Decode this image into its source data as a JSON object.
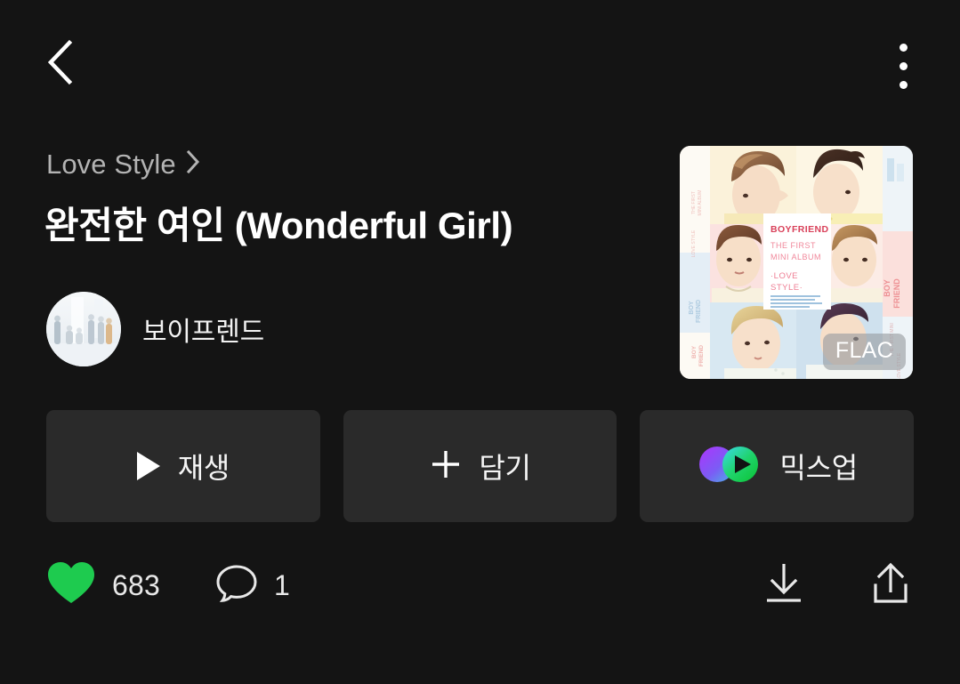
{
  "theme": {
    "background": "#141414",
    "button_bg": "#2a2a2a",
    "text_primary": "#ffffff",
    "text_secondary": "#b3b3b3",
    "accent_like": "#1ecb4f",
    "mix_purple": "#9b4dff",
    "mix_blue": "#4f8fff",
    "mix_cyan": "#2ed3c6",
    "mix_green": "#18d24a"
  },
  "topbar": {
    "back_icon": "chevron-left-icon",
    "menu_icon": "kebab-menu-icon"
  },
  "breadcrumb": {
    "label": "Love Style",
    "chevron_icon": "chevron-right-icon"
  },
  "track": {
    "title": "완전한 여인 (Wonderful Girl)"
  },
  "artist": {
    "name": "보이프렌드",
    "avatar_icon": "artist-avatar"
  },
  "album_art": {
    "quality_badge": "FLAC",
    "cover_text": {
      "brand": "BOYFRIEND",
      "line1": "THE FIRST",
      "line2": "MINI ALBUM",
      "line3": "·LOVE",
      "line4": "STYLE·",
      "side_vertical": "BOYFRIEND"
    }
  },
  "actions": [
    {
      "label": "재생",
      "icon": "play-icon",
      "name": "play-button"
    },
    {
      "label": "담기",
      "icon": "plus-icon",
      "name": "add-to-playlist-button"
    },
    {
      "label": "믹스업",
      "icon": "mixup-icon",
      "name": "mixup-button"
    }
  ],
  "stats": {
    "like": {
      "icon": "heart-icon",
      "value": "683"
    },
    "comment": {
      "icon": "comment-bubble-icon",
      "value": "1"
    },
    "download_icon": "download-icon",
    "share_icon": "share-icon"
  }
}
